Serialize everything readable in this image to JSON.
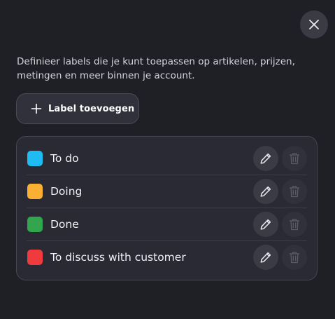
{
  "dialog": {
    "close_icon": "close-icon",
    "description": "Definieer labels die je kunt toepassen op artikelen, prijzen, metingen en meer binnen je account.",
    "add_button_label": "Label toevoegen",
    "add_button_icon": "plus-icon"
  },
  "labels": [
    {
      "name": "To do",
      "color": "#1ebcf2",
      "edit_icon": "pencil-icon",
      "delete_icon": "trash-icon"
    },
    {
      "name": "Doing",
      "color": "#fbb034",
      "edit_icon": "pencil-icon",
      "delete_icon": "trash-icon"
    },
    {
      "name": "Done",
      "color": "#33a54c",
      "edit_icon": "pencil-icon",
      "delete_icon": "trash-icon"
    },
    {
      "name": "To discuss with customer",
      "color": "#ef3b3d",
      "edit_icon": "pencil-icon",
      "delete_icon": "trash-icon"
    }
  ],
  "colors": {
    "background": "#1f1f26",
    "panel": "#292a33",
    "button": "#3a3b45"
  }
}
